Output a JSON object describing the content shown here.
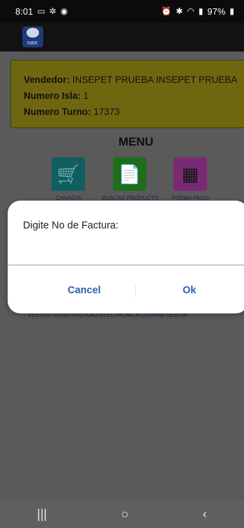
{
  "status_bar": {
    "time": "8:01",
    "battery": "97%",
    "icons_left": [
      "laptop-icon",
      "settings-icon",
      "spotify-icon"
    ],
    "icons_right": [
      "alarm-icon",
      "bluetooth-icon",
      "wifi-icon",
      "signal-icon",
      "battery-icon"
    ]
  },
  "app": {
    "logo_text": "NBK"
  },
  "info": {
    "vendedor_label": "Vendedor:",
    "vendedor_value": "INSEPET PRUEBA  INSEPET PRUEBA",
    "isla_label": "Numero Isla:",
    "isla_value": "1",
    "turno_label": "Numero Turno:",
    "turno_value": "17373"
  },
  "menu": {
    "title": "MENU",
    "items": [
      {
        "label": "CANASTA",
        "icon": "cart-icon",
        "color": "#0f5f5f"
      },
      {
        "label": "BUSCAR PRODUCTO",
        "icon": "document-search-icon",
        "color": "#1f6d1a"
      },
      {
        "label": "FORMA PAGO",
        "icon": "pos-terminal-icon",
        "color": "#7a2a75"
      }
    ]
  },
  "bottom_links": "VENTAS TURNO   FACTURA ELECTRONICA   CERRAR SESION",
  "dialog": {
    "title": "Digite No de Factura:",
    "input_value": "",
    "cancel_label": "Cancel",
    "ok_label": "Ok"
  },
  "nav": {
    "recent": "|||",
    "home": "○",
    "back": "‹"
  }
}
